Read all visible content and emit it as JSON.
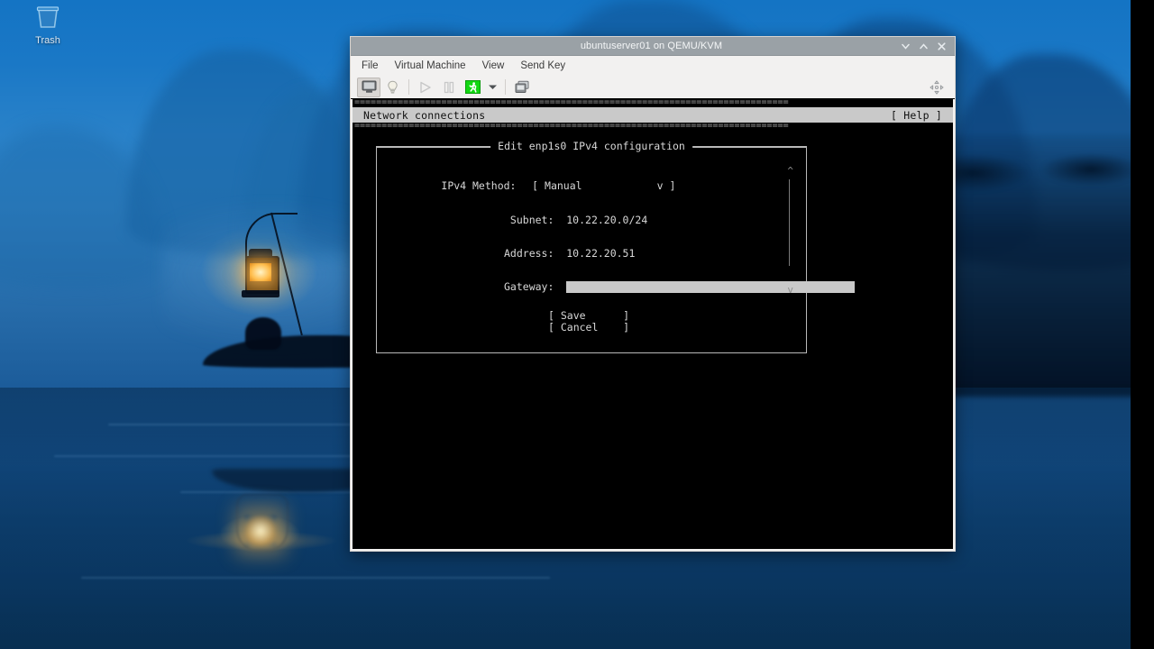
{
  "desktop": {
    "trash": {
      "label": "Trash",
      "icon": "trash-icon"
    }
  },
  "vm_window": {
    "title": "ubuntuserver01 on QEMU/KVM",
    "window_controls": [
      {
        "name": "minimize",
        "glyph": "v"
      },
      {
        "name": "maximize",
        "glyph": "^"
      },
      {
        "name": "close",
        "glyph": "x"
      }
    ],
    "menu": [
      {
        "label": "File"
      },
      {
        "label": "Virtual Machine"
      },
      {
        "label": "View"
      },
      {
        "label": "Send Key"
      }
    ],
    "toolbar": [
      {
        "name": "show-console-button",
        "icon": "monitor-icon",
        "state": "pressed"
      },
      {
        "name": "show-details-button",
        "icon": "lightbulb-icon",
        "state": "normal"
      },
      {
        "name": "run-button",
        "icon": "play-icon",
        "state": "disabled"
      },
      {
        "name": "pause-button",
        "icon": "pause-icon",
        "state": "disabled"
      },
      {
        "name": "shutdown-button",
        "icon": "shutdown-running-man-icon",
        "state": "normal"
      },
      {
        "name": "shutdown-menu-button",
        "icon": "chevron-down-icon",
        "state": "normal"
      },
      {
        "name": "snapshots-button",
        "icon": "snapshots-icon",
        "state": "normal"
      },
      {
        "name": "fullscreen-button",
        "icon": "fullscreen-arrows-icon",
        "state": "normal"
      }
    ]
  },
  "tui": {
    "rule_top": "================================================================================",
    "rule_bottom": "================================================================================",
    "header": {
      "title": "Network connections",
      "help": "[ Help ]"
    },
    "dialog": {
      "title": "Edit enp1s0 IPv4 configuration",
      "fields": [
        {
          "label": "IPv4 Method:",
          "type": "dropdown",
          "value": "[ Manual            v ]"
        },
        {
          "label": "Subnet:",
          "type": "text",
          "value": "10.22.20.0/24"
        },
        {
          "label": "Address:",
          "type": "text",
          "value": "10.22.20.51"
        },
        {
          "label": "Gateway:",
          "type": "input",
          "value": "",
          "focused": true
        }
      ],
      "buttons": [
        {
          "label": "[ Save      ]",
          "name": "save"
        },
        {
          "label": "[ Cancel    ]",
          "name": "cancel"
        }
      ],
      "scroll": {
        "up": "^",
        "down": "v"
      }
    }
  },
  "colors": {
    "titlebar": "#9aa1a6",
    "chrome": "#f2f1f0",
    "terminal_bg": "#000000",
    "terminal_fg": "#d8d8d8",
    "tui_header_bg": "#c9c9c9",
    "input_focus_bg": "#c9c9c9",
    "accent_green": "#1fd41f"
  }
}
